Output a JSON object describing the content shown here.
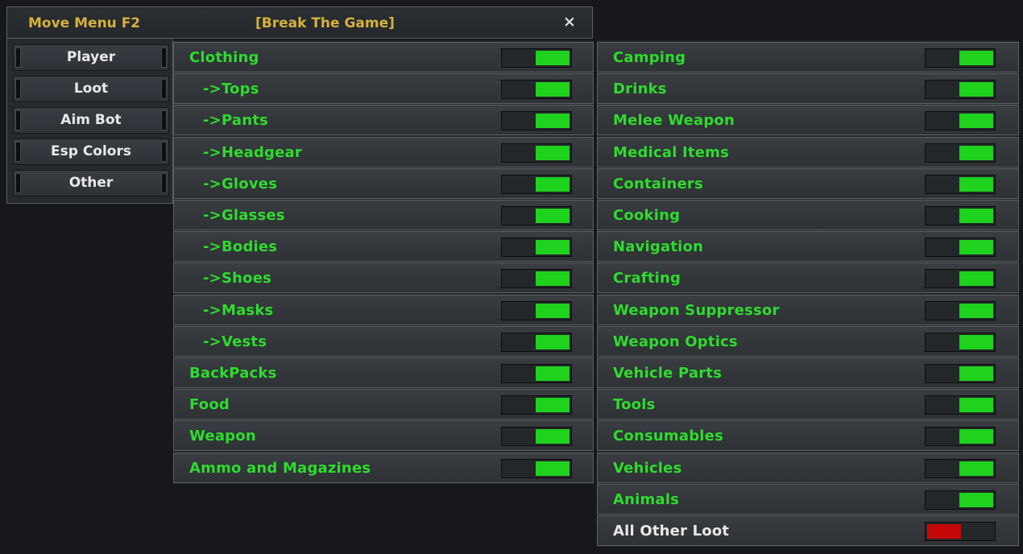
{
  "window": {
    "title": "Move Menu F2",
    "subtitle": "[Break The Game]",
    "close_label": "×"
  },
  "nav": [
    {
      "label": "Player",
      "active": false
    },
    {
      "label": "Loot",
      "active": true
    },
    {
      "label": "Aim Bot",
      "active": false
    },
    {
      "label": "Esp Colors",
      "active": false
    },
    {
      "label": "Other",
      "active": false
    }
  ],
  "left_items": [
    {
      "label": "Clothing",
      "on": true,
      "sub": false
    },
    {
      "label": "->Tops",
      "on": true,
      "sub": true
    },
    {
      "label": "->Pants",
      "on": true,
      "sub": true
    },
    {
      "label": "->Headgear",
      "on": true,
      "sub": true
    },
    {
      "label": "->Gloves",
      "on": true,
      "sub": true
    },
    {
      "label": "->Glasses",
      "on": true,
      "sub": true
    },
    {
      "label": "->Bodies",
      "on": true,
      "sub": true
    },
    {
      "label": "->Shoes",
      "on": true,
      "sub": true
    },
    {
      "label": "->Masks",
      "on": true,
      "sub": true
    },
    {
      "label": "->Vests",
      "on": true,
      "sub": true
    },
    {
      "label": "BackPacks",
      "on": true,
      "sub": false
    },
    {
      "label": "Food",
      "on": true,
      "sub": false
    },
    {
      "label": "Weapon",
      "on": true,
      "sub": false
    },
    {
      "label": "Ammo and Magazines",
      "on": true,
      "sub": false
    }
  ],
  "right_items": [
    {
      "label": "Camping",
      "on": true
    },
    {
      "label": "Drinks",
      "on": true
    },
    {
      "label": "Melee Weapon",
      "on": true
    },
    {
      "label": "Medical Items",
      "on": true
    },
    {
      "label": "Containers",
      "on": true
    },
    {
      "label": "Cooking",
      "on": true
    },
    {
      "label": "Navigation",
      "on": true
    },
    {
      "label": "Crafting",
      "on": true
    },
    {
      "label": "Weapon Suppressor",
      "on": true
    },
    {
      "label": "Weapon Optics",
      "on": true
    },
    {
      "label": "Vehicle Parts",
      "on": true
    },
    {
      "label": "Tools",
      "on": true
    },
    {
      "label": "Consumables",
      "on": true
    },
    {
      "label": "Vehicles",
      "on": true
    },
    {
      "label": "Animals",
      "on": true
    },
    {
      "label": "All Other Loot",
      "on": false,
      "white_label": true
    }
  ],
  "colors": {
    "accent": "#d4b23a",
    "label_green": "#2edb2e",
    "toggle_on": "#1ed21e",
    "toggle_off": "#c40808"
  }
}
